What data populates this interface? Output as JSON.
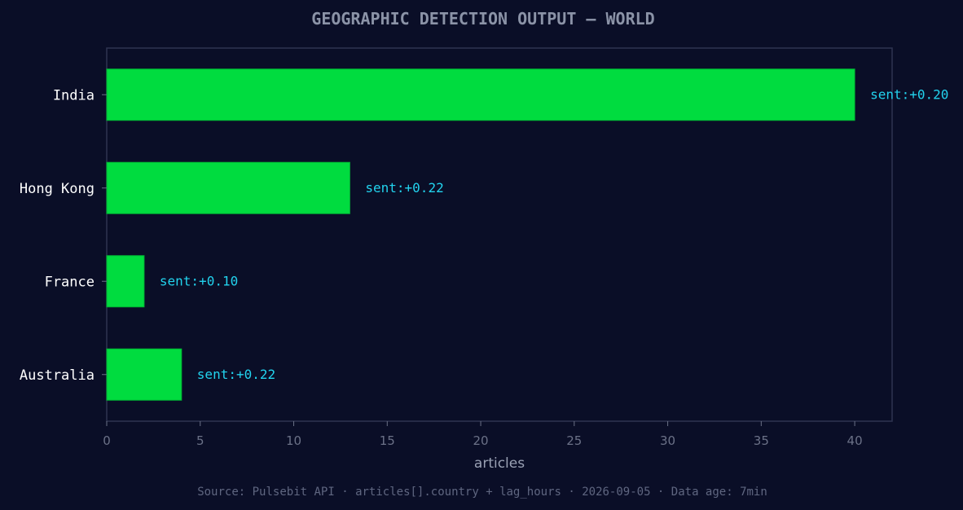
{
  "chart_data": {
    "type": "bar",
    "orientation": "horizontal",
    "title": "GEOGRAPHIC DETECTION OUTPUT — WORLD",
    "xlabel": "articles",
    "ylabel": "",
    "xlim": [
      0,
      42
    ],
    "xticks": [
      0,
      5,
      10,
      15,
      20,
      25,
      30,
      35,
      40
    ],
    "categories": [
      "India",
      "Hong Kong",
      "France",
      "Australia"
    ],
    "values": [
      40,
      13,
      2,
      4
    ],
    "data_labels": [
      "sent:+0.20",
      "sent:+0.22",
      "sent:+0.10",
      "sent:+0.22"
    ],
    "grid": false,
    "source": "Source: Pulsebit API · articles[].country + lag_hours · 2026-09-05 · Data age: 7min"
  },
  "colors": {
    "background": "#0a0e27",
    "bar": "#00dc3f",
    "data_label": "#22d3ee",
    "frame": "#2e3450"
  }
}
